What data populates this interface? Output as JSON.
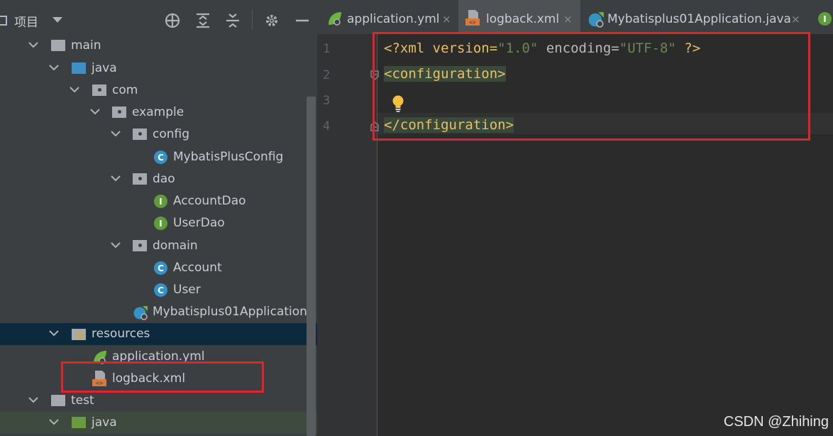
{
  "project": {
    "title": "项目"
  },
  "tree": {
    "main": "main",
    "java": "java",
    "com": "com",
    "example": "example",
    "config": "config",
    "mybatis_plus_config": "MybatisPlusConfig",
    "dao": "dao",
    "account_dao": "AccountDao",
    "user_dao": "UserDao",
    "domain": "domain",
    "account": "Account",
    "user": "User",
    "application_class": "Mybatisplus01Application",
    "resources": "resources",
    "application_yml": "application.yml",
    "logback_xml": "logback.xml",
    "test": "test",
    "test_java": "java",
    "badge_c": "C",
    "badge_i": "I"
  },
  "tabs": [
    {
      "label": "application.yml"
    },
    {
      "label": "logback.xml"
    },
    {
      "label": "Mybatisplus01Application.java"
    }
  ],
  "tab_close": "×",
  "editor": {
    "line_numbers": [
      "1",
      "2",
      "3",
      "4"
    ],
    "line1": {
      "p1": "<?xml version=",
      "v1": "\"1.0\"",
      "p2": " encoding=",
      "v2": "\"UTF-8\"",
      "p3": " ?>"
    },
    "line2": {
      "open_bracket": "<",
      "tag": "configuration",
      "close_bracket": ">"
    },
    "line4": {
      "open_bracket": "</",
      "tag": "configuration",
      "close_bracket": ">"
    }
  },
  "watermark": "CSDN @Zhihing",
  "colors": {
    "accent": "#4a88c7",
    "annotation_red": "#e5212b",
    "xml_tag": "#e8bf6a",
    "xml_value": "#6a8759",
    "xml_plain": "#a9b7c6"
  }
}
